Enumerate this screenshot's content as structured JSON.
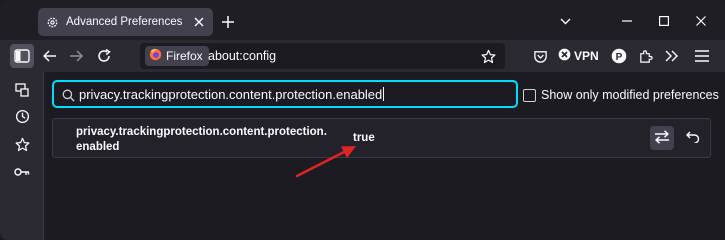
{
  "tab": {
    "title": "Advanced Preferences",
    "icon": "gear-icon",
    "close_icon": "close-icon"
  },
  "toolbar": {
    "identity_label": "Firefox",
    "url": "about:config",
    "vpn_label": "VPN",
    "profile_initial": "P",
    "icons": [
      "sidebar-icon",
      "back-icon",
      "forward-icon",
      "reload-icon",
      "firefox-logo",
      "bookmark-star-icon",
      "save-to-pocket-icon",
      "vpn-icon",
      "profile-icon",
      "extensions-icon",
      "overflow-chevron-icon",
      "menu-icon"
    ]
  },
  "sidebar": {
    "icons": [
      "synced-tabs-icon",
      "history-icon",
      "bookmarks-icon",
      "passwords-icon"
    ]
  },
  "search": {
    "value": "privacy.trackingprotection.content.protection.enabled",
    "icon": "search-icon"
  },
  "filter": {
    "label": "Show only modified preferences",
    "checked": false
  },
  "preference": {
    "name_line1": "privacy.trackingprotection.content.protection.",
    "name_line2": "enabled",
    "value": "true",
    "toggle_icon": "toggle-swap-icon",
    "reset_icon": "reset-undo-icon"
  },
  "colors": {
    "accent": "#00ddff",
    "annotation_arrow": "#e02424",
    "background": "#1c1b22",
    "toolbar": "#2b2a33"
  }
}
